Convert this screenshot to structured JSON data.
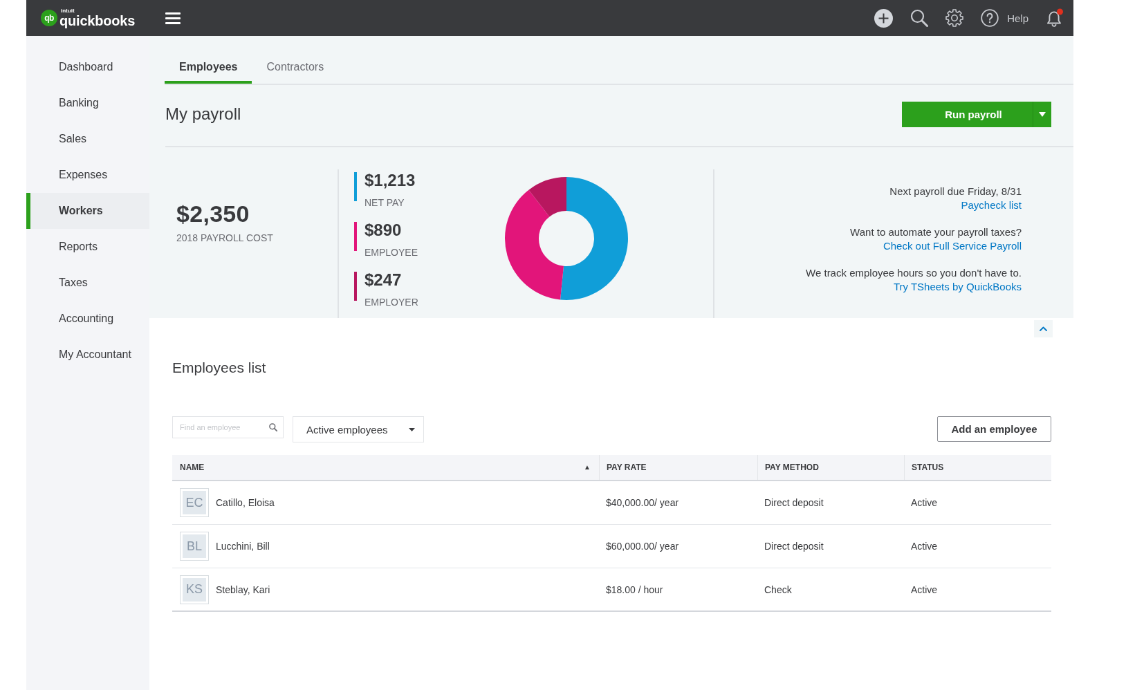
{
  "top_bar": {
    "logo": {
      "mark": "qb",
      "company": "intuit",
      "product": "quickbooks"
    },
    "help_label": "Help"
  },
  "sidebar": {
    "items": [
      {
        "label": "Dashboard",
        "selected": false
      },
      {
        "label": "Banking",
        "selected": false
      },
      {
        "label": "Sales",
        "selected": false
      },
      {
        "label": "Expenses",
        "selected": false
      },
      {
        "label": "Workers",
        "selected": true
      },
      {
        "label": "Reports",
        "selected": false
      },
      {
        "label": "Taxes",
        "selected": false
      },
      {
        "label": "Accounting",
        "selected": false
      },
      {
        "label": "My Accountant",
        "selected": false
      }
    ]
  },
  "tabs": [
    {
      "label": "Employees",
      "selected": true
    },
    {
      "label": "Contractors",
      "selected": false
    }
  ],
  "page_title": "My payroll",
  "run_payroll_button": {
    "label": "Run payroll"
  },
  "summary": {
    "total": {
      "amount": "$2,350",
      "label": "2018 PAYROLL COST"
    },
    "breakdown": [
      {
        "amount": "$1,213",
        "color": "#109ed8"
      },
      {
        "amount": "$890",
        "color": "#e2157a"
      },
      {
        "amount": "$247",
        "color": "#b8175f"
      }
    ],
    "chart_data": {
      "type": "donut",
      "categories": [
        "NET PAY",
        "EMPLOYEE",
        "EMPLOYER"
      ],
      "values": [
        51.6,
        37.9,
        10.5
      ]
    },
    "notices": [
      {
        "text": "Next payroll due Friday, 8/31",
        "link": "Paycheck list"
      },
      {
        "text": "Want to automate your payroll taxes?",
        "link": "Check out Full Service Payroll"
      },
      {
        "text": "We track employee hours so you don't have to.",
        "link": "Try TSheets by QuickBooks"
      }
    ]
  },
  "employees_list": {
    "title": "Employees list",
    "search": {
      "placeholder": "Find an employee"
    },
    "filter": {
      "value": "Active employees"
    },
    "add_button": {
      "label": "Add an employee"
    },
    "table": {
      "columns": [
        {
          "label": "NAME",
          "sort_mark": "▲"
        },
        {
          "label": "PAY RATE"
        },
        {
          "label": "PAY METHOD"
        },
        {
          "label": "STATUS"
        }
      ],
      "rows": [
        {
          "initials": "EC",
          "name": "Catillo, Eloisa",
          "pay_rate": "$40,000.00/ year",
          "pay_method": "Direct deposit",
          "status": "Active"
        },
        {
          "initials": "BL",
          "name": "Lucchini, Bill",
          "pay_rate": "$60,000.00/ year",
          "pay_method": "Direct deposit",
          "status": "Active"
        },
        {
          "initials": "KS",
          "name": "Steblay, Kari",
          "pay_rate": "$18.00 / hour",
          "pay_method": "Check",
          "status": "Active"
        }
      ]
    }
  }
}
